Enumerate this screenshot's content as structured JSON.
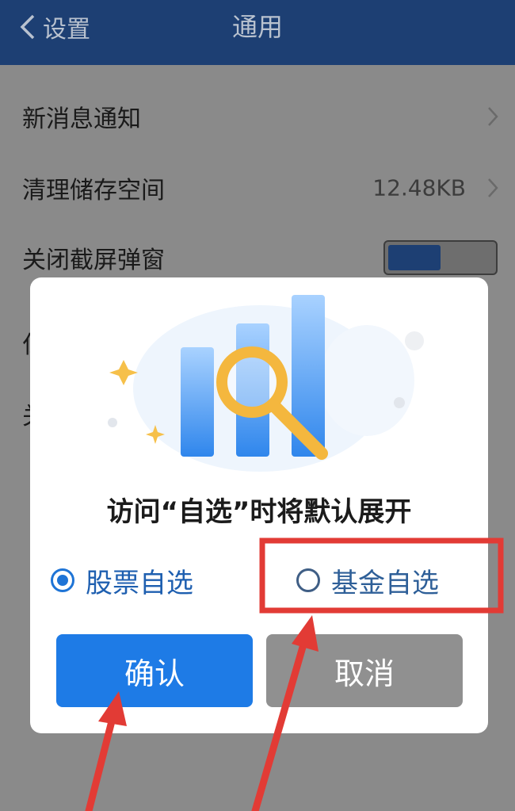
{
  "header": {
    "back_label": "设置",
    "title": "通用"
  },
  "settings": {
    "rows": [
      {
        "label": "新消息通知"
      },
      {
        "label": "清理储存空间",
        "value": "12.48KB"
      },
      {
        "label": "关闭截屏弹窗",
        "toggle": true
      }
    ],
    "partial_rows": [
      "仁",
      "关"
    ]
  },
  "dialog": {
    "title": "访问“自选”时将默认展开",
    "options": [
      {
        "label": "股票自选",
        "selected": true
      },
      {
        "label": "基金自选",
        "selected": false
      }
    ],
    "confirm_label": "确认",
    "cancel_label": "取消"
  },
  "colors": {
    "header_bg": "#1d3f73",
    "accent": "#1e7be6",
    "annotation": "#e23b35"
  }
}
